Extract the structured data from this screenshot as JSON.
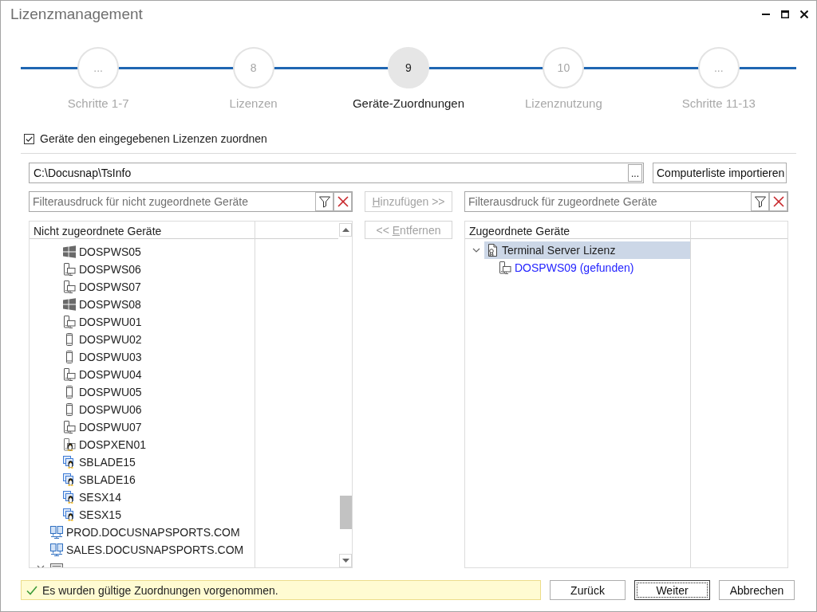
{
  "window": {
    "title": "Lizenzmanagement"
  },
  "steps": [
    {
      "number": "...",
      "label": "Schritte 1-7",
      "selected": false
    },
    {
      "number": "8",
      "label": "Lizenzen",
      "selected": false
    },
    {
      "number": "9",
      "label": "Geräte-Zuordnungen",
      "selected": true
    },
    {
      "number": "10",
      "label": "Lizenznutzung",
      "selected": false
    },
    {
      "number": "...",
      "label": "Schritte 11-13",
      "selected": false
    }
  ],
  "assign_option": {
    "label": "Geräte den eingegebenen Lizenzen zuordnen",
    "checked": true
  },
  "source": {
    "path": "C:\\Docusnap\\TsInfo",
    "browse_button": "...",
    "import_button": "Computerliste importieren"
  },
  "unassigned": {
    "filter_placeholder": "Filterausdruck für nicht zugeordnete Geräte",
    "column": "Nicht zugeordnete Geräte",
    "nodes": [
      {
        "children": [
          {
            "name": "DOSPWS05",
            "kind": "windows",
            "selected": false
          },
          {
            "name": "DOSPWS06",
            "kind": "device",
            "selected": false
          },
          {
            "name": "DOSPWS07",
            "kind": "device",
            "selected": false
          },
          {
            "name": "DOSPWS08",
            "kind": "windows",
            "selected": false
          },
          {
            "name": "DOSPWU01",
            "kind": "device",
            "selected": false
          },
          {
            "name": "DOSPWU02",
            "kind": "mobile",
            "selected": false
          },
          {
            "name": "DOSPWU03",
            "kind": "mobile",
            "selected": false
          },
          {
            "name": "DOSPWU04",
            "kind": "device",
            "selected": false
          },
          {
            "name": "DOSPWU05",
            "kind": "mobile",
            "selected": false
          },
          {
            "name": "DOSPWU06",
            "kind": "mobile",
            "selected": false
          },
          {
            "name": "DOSPWU07",
            "kind": "device",
            "selected": false
          },
          {
            "name": "DOSPXEN01",
            "kind": "linux-device",
            "selected": false
          },
          {
            "name": "SBLADE15",
            "kind": "linux-vm",
            "selected": false
          },
          {
            "name": "SBLADE16",
            "kind": "linux-vm",
            "selected": false
          },
          {
            "name": "SESX14",
            "kind": "linux-vm",
            "selected": false
          },
          {
            "name": "SESX15",
            "kind": "linux-vm",
            "selected": false
          }
        ]
      },
      {
        "name": "PROD.DOCUSNAPSPORTS.COM",
        "kind": "domain",
        "selected": false
      },
      {
        "name": "SALES.DOCUSNAPSPORTS.COM",
        "kind": "domain",
        "selected": false
      },
      {
        "kind": "asset",
        "selected": false,
        "expanded": true
      }
    ]
  },
  "add_button": {
    "access_key": "H",
    "after": "inzufügen >>",
    "disabled": true
  },
  "assigned": {
    "filter_placeholder": "Filterausdruck für zugeordnete Geräte",
    "column": "Zugeordnete Geräte",
    "nodes": [
      {
        "name": "Terminal Server Lizenz",
        "kind": "license",
        "selected": true,
        "expanded": true,
        "children": [
          {
            "name": "DOSPWS09 (gefunden)",
            "kind": "device",
            "selected": false,
            "matched": true
          }
        ]
      }
    ]
  },
  "remove_button": {
    "before": "<< ",
    "access_key": "E",
    "after": "ntfernen",
    "disabled": true
  },
  "status": {
    "kind": "success",
    "text": "Es wurden gültige Zuordnungen vorgenommen."
  },
  "buttons": [
    {
      "label": "Zurück",
      "default": false
    },
    {
      "label": "Weiter",
      "default": true
    },
    {
      "label": "Abbrechen",
      "default": false
    }
  ]
}
